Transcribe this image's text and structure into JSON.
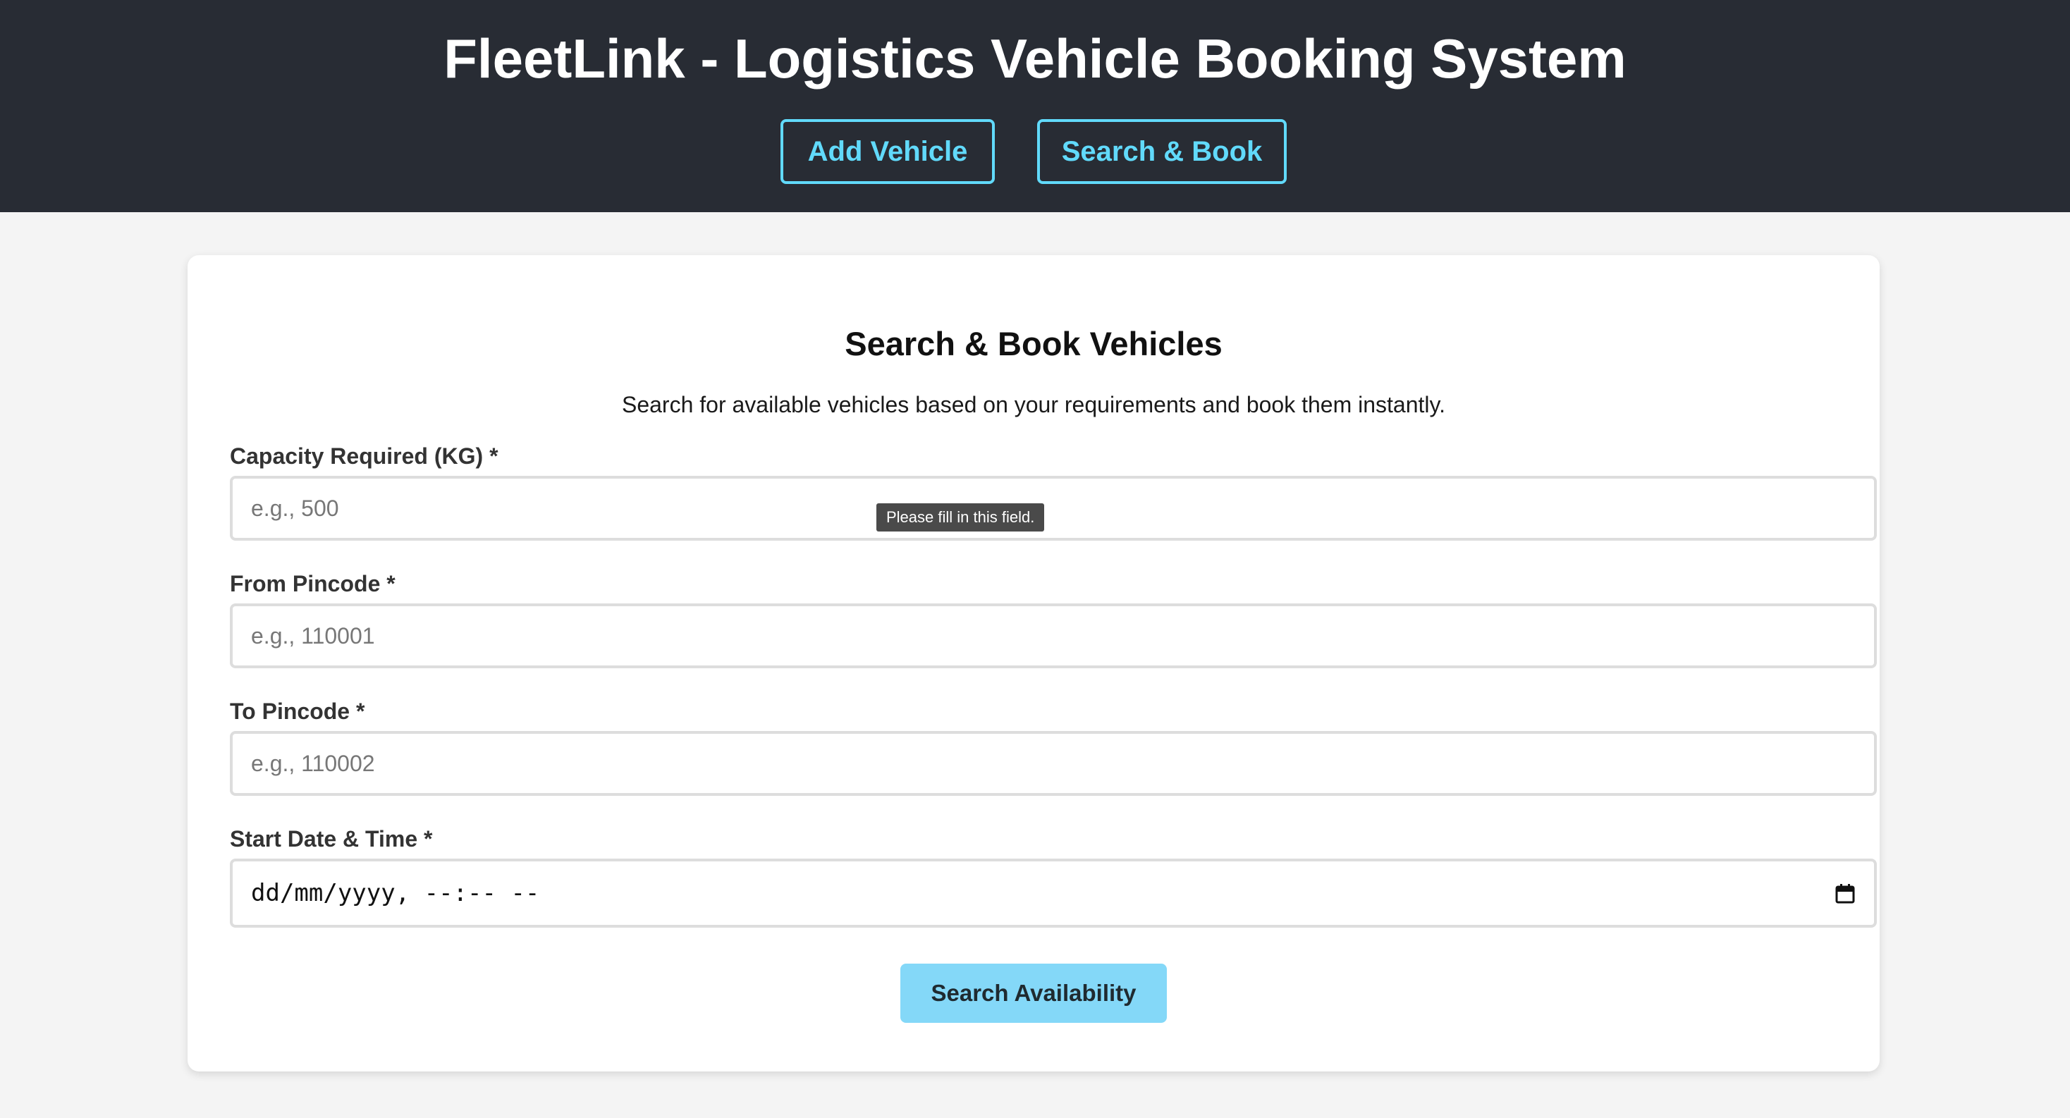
{
  "header": {
    "title": "FleetLink - Logistics Vehicle Booking System",
    "nav": {
      "add_vehicle": "Add Vehicle",
      "search_book": "Search & Book"
    }
  },
  "colors": {
    "header_bg": "#282c34",
    "accent": "#61dafb",
    "button_bg": "#84d8f8",
    "page_bg": "#f4f4f4"
  },
  "form": {
    "title": "Search & Book Vehicles",
    "subtitle": "Search for available vehicles based on your requirements and book them instantly.",
    "capacity": {
      "label": "Capacity Required (KG) *",
      "placeholder": "e.g., 500",
      "value": ""
    },
    "from_pincode": {
      "label": "From Pincode *",
      "placeholder": "e.g., 110001",
      "value": ""
    },
    "to_pincode": {
      "label": "To Pincode *",
      "placeholder": "e.g., 110002",
      "value": ""
    },
    "start_datetime": {
      "label": "Start Date & Time *",
      "display": "dd/mm/yyyy, --:-- --",
      "icon": "calendar-icon"
    },
    "submit_label": "Search Availability"
  },
  "validation_tooltip": "Please fill in this field."
}
